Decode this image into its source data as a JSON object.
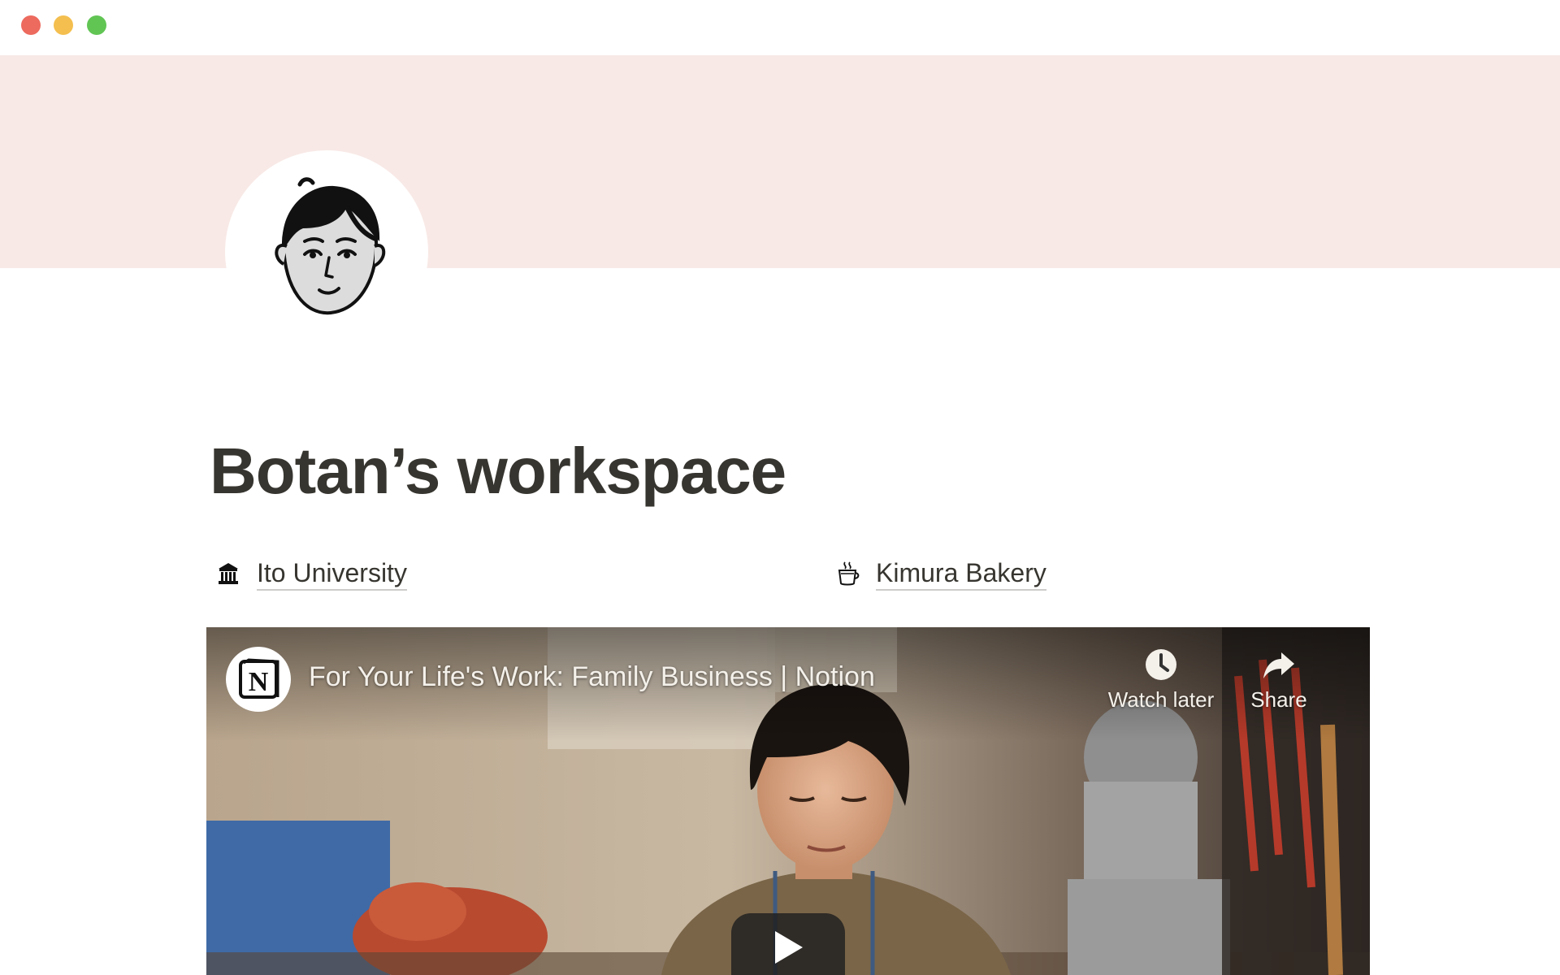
{
  "window": {
    "controls": {
      "close_color": "#ed6a5e",
      "minimize_color": "#f4bf4f",
      "maximize_color": "#61c554"
    }
  },
  "cover": {
    "color": "#f8e9e6"
  },
  "avatar": {
    "icon": "person-portrait-icon"
  },
  "page": {
    "title": "Botan’s workspace"
  },
  "links": [
    {
      "icon": "university-building-icon",
      "label": "Ito University"
    },
    {
      "icon": "coffee-cup-icon",
      "label": "Kimura Bakery"
    }
  ],
  "video": {
    "title": "For Your Life's Work: Family Business | Notion",
    "channel_logo": "notion-logo-icon",
    "actions": {
      "watch_later_label": "Watch later",
      "share_label": "Share"
    },
    "play_icon": "play-icon"
  }
}
